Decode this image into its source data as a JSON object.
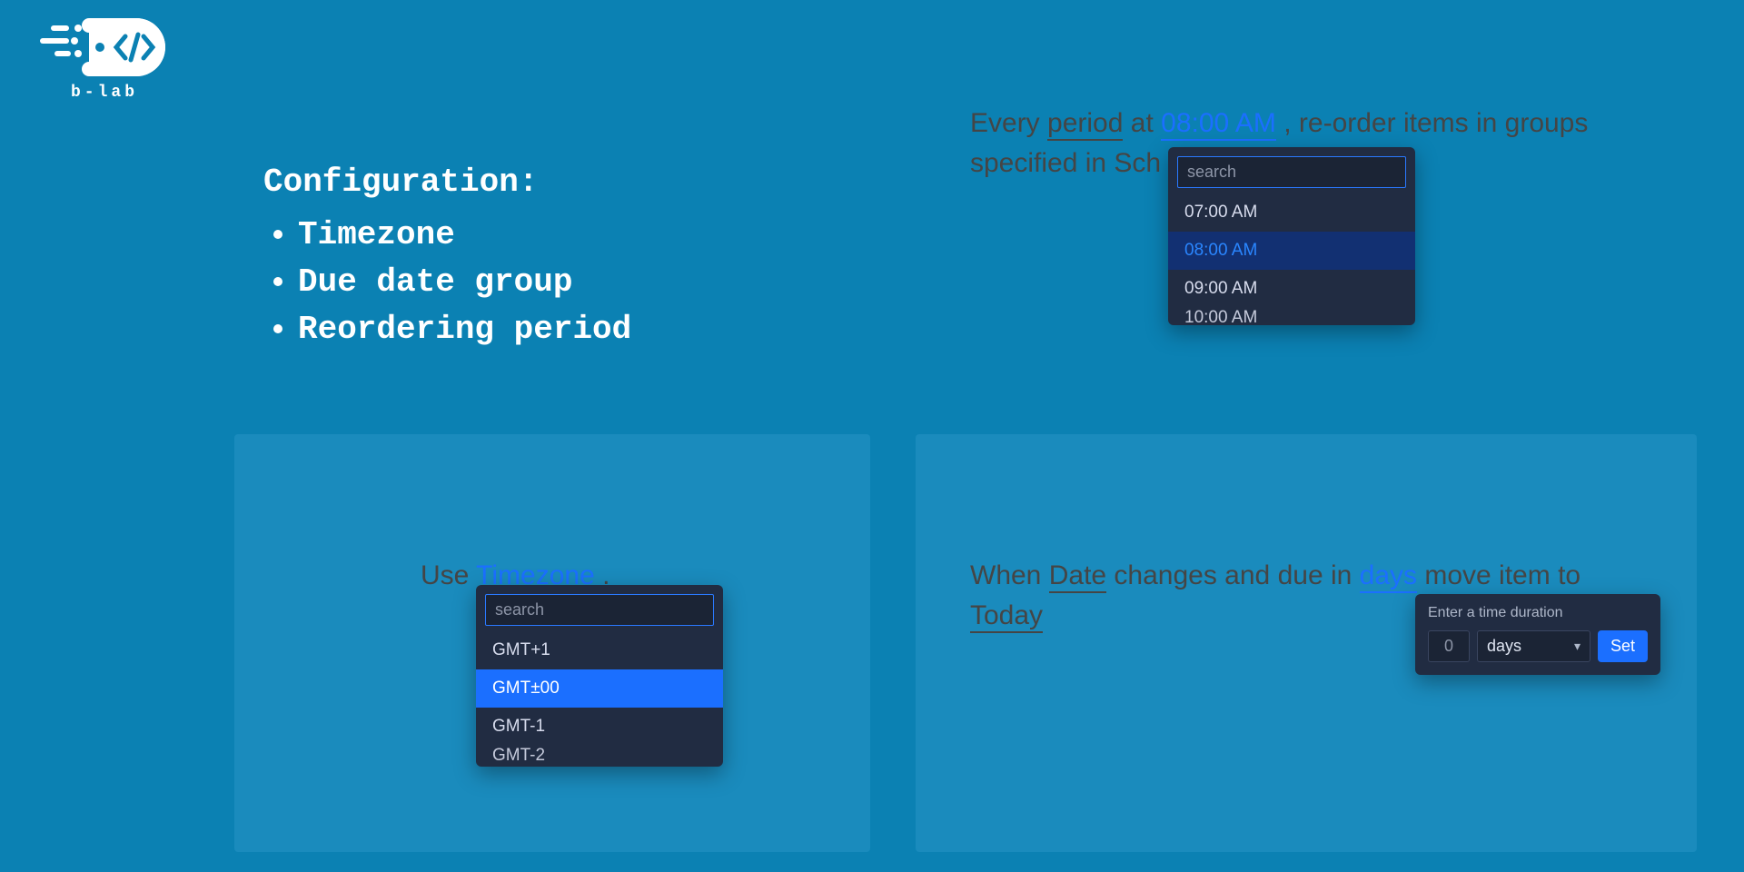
{
  "logo": {
    "text": "b-lab"
  },
  "config": {
    "heading": "Configuration:",
    "items": [
      "Timezone",
      "Due date group",
      "Reordering period"
    ]
  },
  "panel1": {
    "t1": "Every ",
    "period": "period",
    "t2": " at ",
    "time": "08:00 AM",
    "t3": " , re-order items in groups specified in Sch"
  },
  "time_dropdown": {
    "search_placeholder": "search",
    "options": [
      "07:00 AM",
      "08:00 AM",
      "09:00 AM",
      "10:00 AM"
    ],
    "selected_index": 1
  },
  "panel2": {
    "t1": "Use ",
    "tz": "Timezone",
    "t2": " ."
  },
  "tz_dropdown": {
    "search_placeholder": "search",
    "options": [
      "GMT+1",
      "GMT±00",
      "GMT-1",
      "GMT-2"
    ],
    "highlight_index": 1
  },
  "panel3": {
    "t1": "When ",
    "date": "Date",
    "t2": " changes and due in ",
    "days": "days",
    "t3": " move item to ",
    "today": "Today"
  },
  "duration": {
    "label": "Enter a time duration",
    "value": "0",
    "unit": "days",
    "set": "Set"
  }
}
